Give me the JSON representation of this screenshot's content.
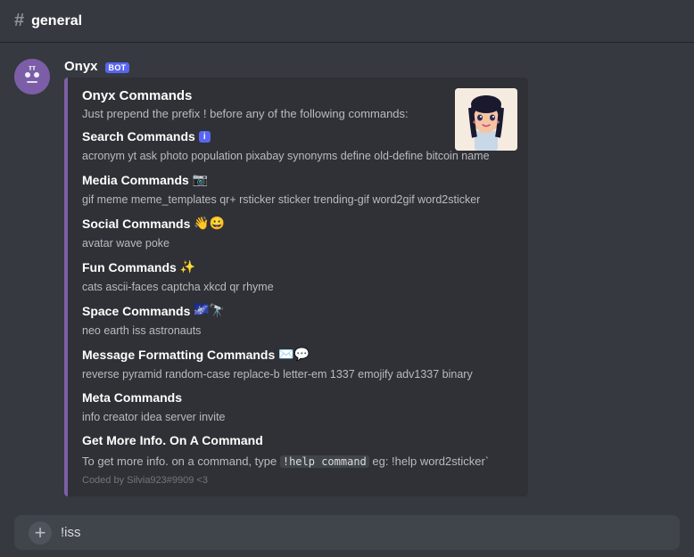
{
  "header": {
    "hash": "#",
    "channel_name": "general"
  },
  "message": {
    "username": "Onyx",
    "bot_tag": "BOT",
    "embed": {
      "title": "Onyx Commands",
      "description": "Just prepend the prefix ! before any of the following commands:",
      "thumbnail_alt": "Anime girl avatar",
      "sections": [
        {
          "id": "search",
          "title": "Search Commands",
          "badge": "i",
          "emoji": "",
          "commands": "acronym  yt  ask  photo  population  pixabay  synonyms  define  old-define  bitcoin  name"
        },
        {
          "id": "media",
          "title": "Media Commands",
          "emoji": "📷",
          "commands": "gif  meme  meme_templates  qr+  rsticker  sticker  trending-gif  word2gif  word2sticker"
        },
        {
          "id": "social",
          "title": "Social Commands",
          "emoji": "👋😀",
          "commands": "avatar  wave  poke"
        },
        {
          "id": "fun",
          "title": "Fun Commands",
          "emoji": "✨",
          "commands": "cats  ascii-faces  captcha  xkcd  qr  rhyme"
        },
        {
          "id": "space",
          "title": "Space Commands",
          "emoji": "🌌🔭",
          "commands": "neo  earth  iss  astronauts"
        },
        {
          "id": "message-formatting",
          "title": "Message Formatting Commands",
          "emoji": "✉️💬",
          "commands": "reverse  pyramid  random-case  replace-b  letter-em  1337  emojify  adv1337  binary"
        },
        {
          "id": "meta",
          "title": "Meta Commands",
          "emoji": "",
          "commands": "info  creator  idea  server  invite"
        }
      ],
      "get_more_info_title": "Get More Info. On A Command",
      "get_more_info_text": "To get more info. on a command, type ",
      "get_more_info_code": "!help command",
      "get_more_info_example": " eg: !help word2sticker`",
      "footer": "Coded by Silvia923#9909 <3"
    }
  },
  "input": {
    "placeholder": "!iss",
    "add_label": "+"
  }
}
